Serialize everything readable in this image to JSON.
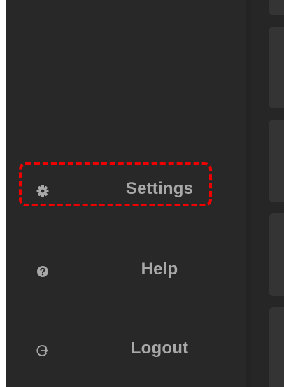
{
  "sidebar": {
    "items": [
      {
        "label": "Settings",
        "icon": "gear-icon",
        "highlighted": true
      },
      {
        "label": "Help",
        "icon": "help-circle-icon",
        "highlighted": false
      },
      {
        "label": "Logout",
        "icon": "logout-icon",
        "highlighted": false
      }
    ]
  },
  "colors": {
    "sidebar_bg": "#282828",
    "content_bg": "#262626",
    "card_bg": "#343434",
    "label_text": "#a8a8a8",
    "icon": "#a8a8a8",
    "highlight_border": "#ee0000"
  }
}
